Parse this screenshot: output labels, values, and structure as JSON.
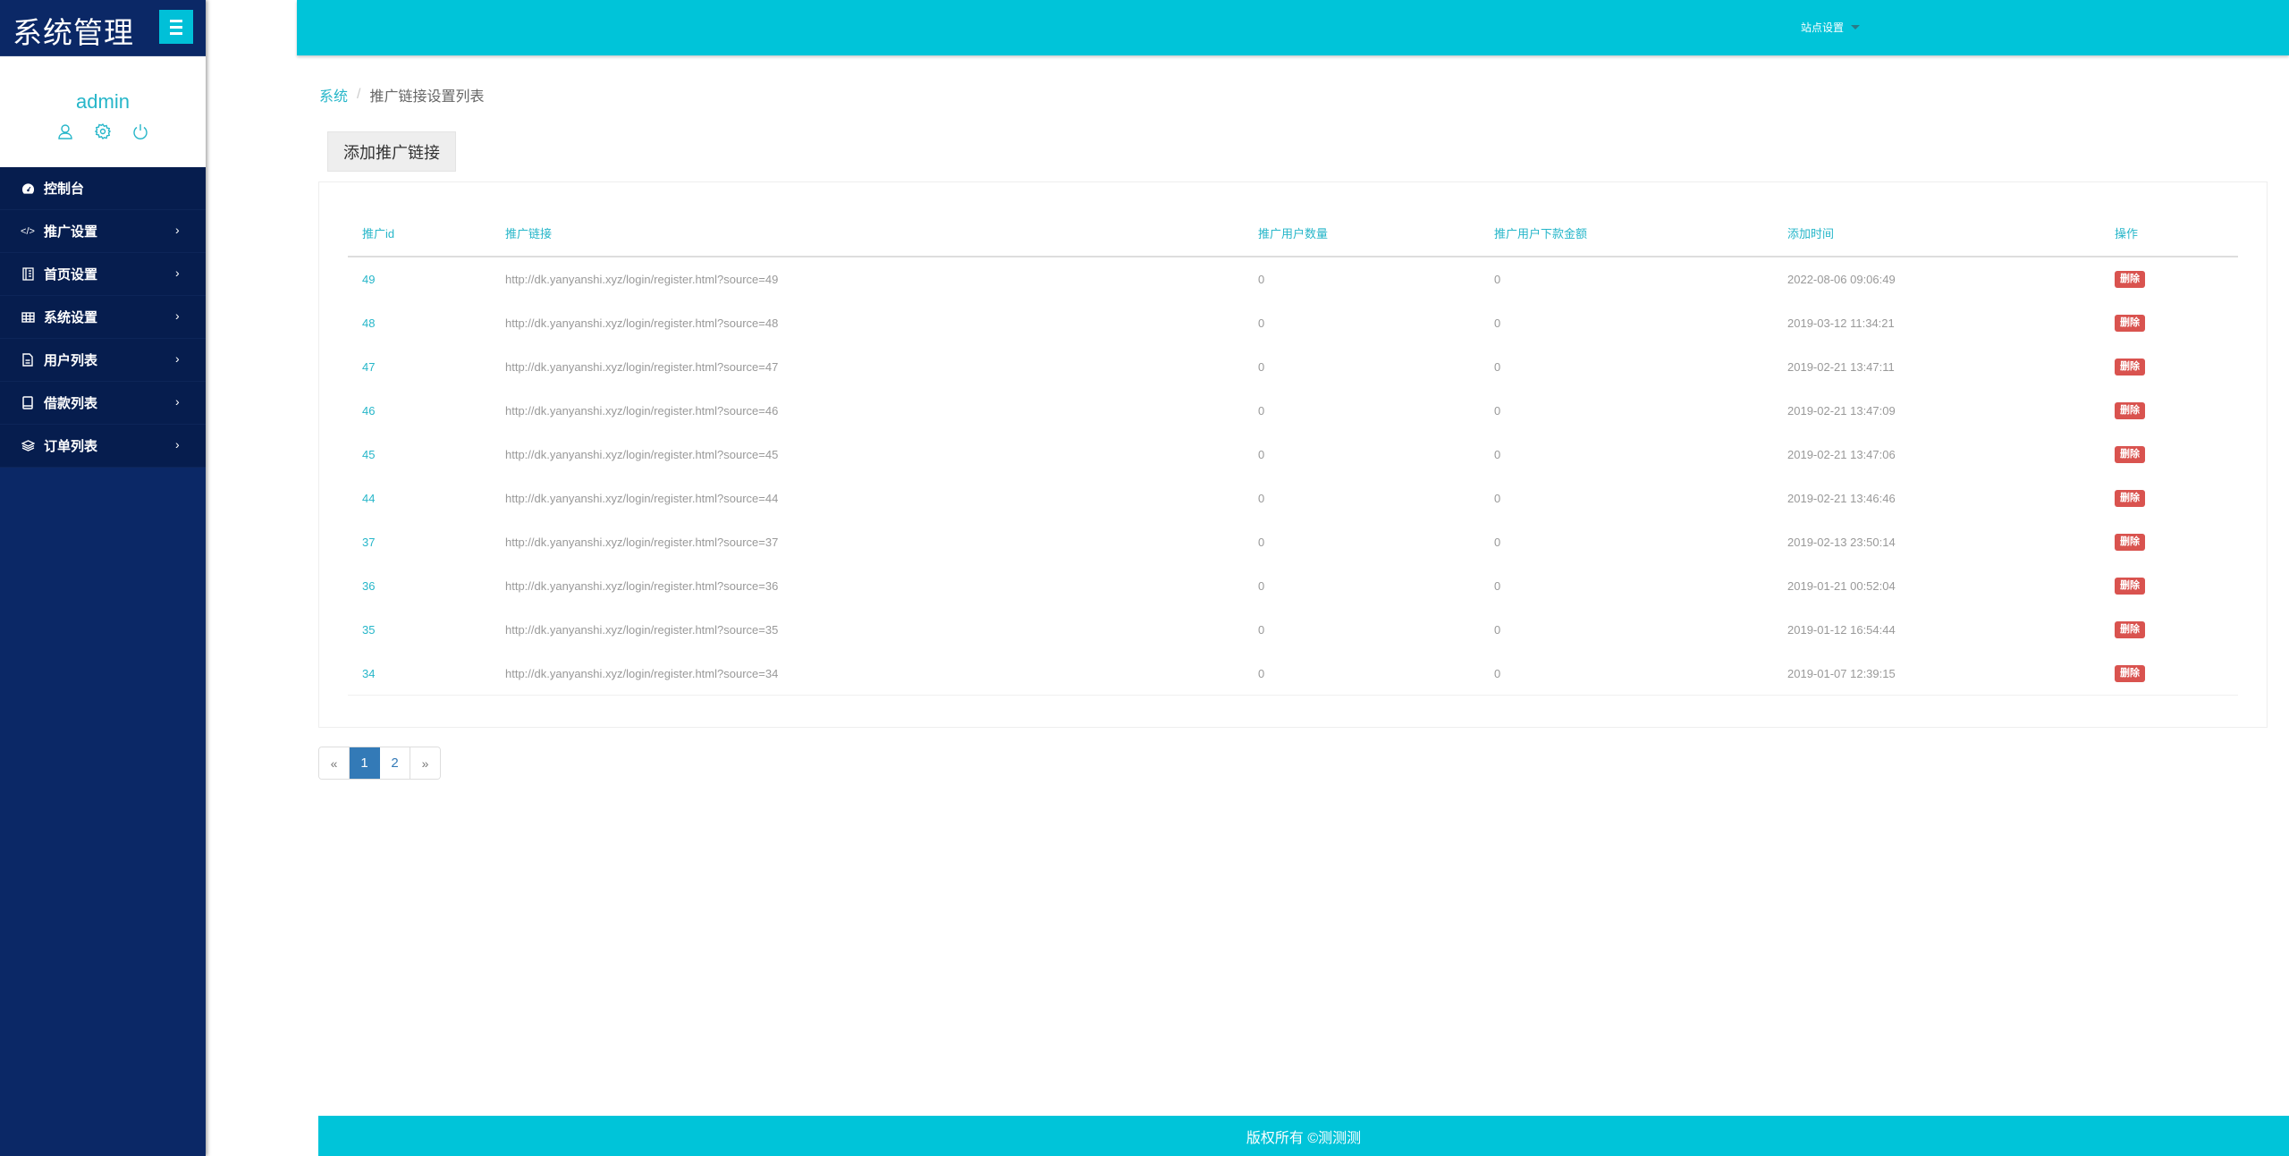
{
  "sidebar": {
    "brand_title": "系统管理",
    "menu_toggle_icon": "hamburger-icon",
    "profile": {
      "name": "admin",
      "icons": [
        "user-icon",
        "gear-icon",
        "power-icon"
      ]
    },
    "items": [
      {
        "label": "控制台",
        "icon": "dashboard-icon",
        "has_submenu": false
      },
      {
        "label": "推广设置",
        "icon": "code-icon",
        "has_submenu": true
      },
      {
        "label": "首页设置",
        "icon": "building-icon",
        "has_submenu": true
      },
      {
        "label": "系统设置",
        "icon": "table-icon",
        "has_submenu": true
      },
      {
        "label": "用户列表",
        "icon": "file-icon",
        "has_submenu": true
      },
      {
        "label": "借款列表",
        "icon": "book-icon",
        "has_submenu": true
      },
      {
        "label": "订单列表",
        "icon": "layers-icon",
        "has_submenu": true
      }
    ],
    "chevron": "›"
  },
  "topbar": {
    "site_settings_label": "站点设置"
  },
  "breadcrumb": {
    "root": "系统",
    "separator": "/",
    "current": "推广链接设置列表"
  },
  "toolbar": {
    "add_label": "添加推广链接"
  },
  "table": {
    "headers": [
      "推广id",
      "推广链接",
      "推广用户数量",
      "推广用户下款金额",
      "添加时间",
      "操作"
    ],
    "rows": [
      {
        "id": "49",
        "link": "http://dk.yanyanshi.xyz/login/register.html?source=49",
        "users": "0",
        "amount": "0",
        "time": "2022-08-06 09:06:49",
        "action": "删除"
      },
      {
        "id": "48",
        "link": "http://dk.yanyanshi.xyz/login/register.html?source=48",
        "users": "0",
        "amount": "0",
        "time": "2019-03-12 11:34:21",
        "action": "删除"
      },
      {
        "id": "47",
        "link": "http://dk.yanyanshi.xyz/login/register.html?source=47",
        "users": "0",
        "amount": "0",
        "time": "2019-02-21 13:47:11",
        "action": "删除"
      },
      {
        "id": "46",
        "link": "http://dk.yanyanshi.xyz/login/register.html?source=46",
        "users": "0",
        "amount": "0",
        "time": "2019-02-21 13:47:09",
        "action": "删除"
      },
      {
        "id": "45",
        "link": "http://dk.yanyanshi.xyz/login/register.html?source=45",
        "users": "0",
        "amount": "0",
        "time": "2019-02-21 13:47:06",
        "action": "删除"
      },
      {
        "id": "44",
        "link": "http://dk.yanyanshi.xyz/login/register.html?source=44",
        "users": "0",
        "amount": "0",
        "time": "2019-02-21 13:46:46",
        "action": "删除"
      },
      {
        "id": "37",
        "link": "http://dk.yanyanshi.xyz/login/register.html?source=37",
        "users": "0",
        "amount": "0",
        "time": "2019-02-13 23:50:14",
        "action": "删除"
      },
      {
        "id": "36",
        "link": "http://dk.yanyanshi.xyz/login/register.html?source=36",
        "users": "0",
        "amount": "0",
        "time": "2019-01-21 00:52:04",
        "action": "删除"
      },
      {
        "id": "35",
        "link": "http://dk.yanyanshi.xyz/login/register.html?source=35",
        "users": "0",
        "amount": "0",
        "time": "2019-01-12 16:54:44",
        "action": "删除"
      },
      {
        "id": "34",
        "link": "http://dk.yanyanshi.xyz/login/register.html?source=34",
        "users": "0",
        "amount": "0",
        "time": "2019-01-07 12:39:15",
        "action": "删除"
      }
    ]
  },
  "pagination": {
    "prev": "«",
    "pages": [
      "1",
      "2"
    ],
    "current": "1",
    "next": "»"
  },
  "footer": {
    "text": "版权所有 ©测测测"
  },
  "colors": {
    "accent": "#00c4d9",
    "sidebar_bg": "#0b2866",
    "menu_bg": "#061d4e",
    "danger": "#d9534f",
    "pagination_active": "#337ab7"
  }
}
